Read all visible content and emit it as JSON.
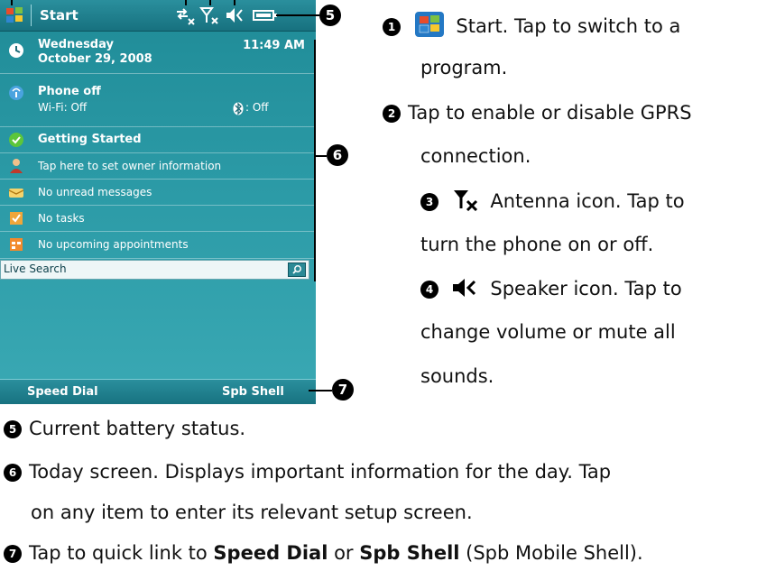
{
  "phone": {
    "title": "Start",
    "today": {
      "date_line1": "Wednesday",
      "date_line2": "October 29, 2008",
      "time": "11:49 AM",
      "phone_title": "Phone off",
      "wifi_status": "Wi-Fi: Off",
      "bluetooth_status": ": Off",
      "getting_started": "Getting Started",
      "owner_info": "Tap here to set owner information",
      "messages": "No unread messages",
      "tasks": "No tasks",
      "appointments": "No upcoming appointments",
      "search_label": "Live Search"
    },
    "softkeys": {
      "left": "Speed Dial",
      "right": "Spb Shell"
    }
  },
  "callout_numbers": {
    "n5": "5",
    "n6": "6",
    "n7": "7"
  },
  "descriptions": {
    "d1": {
      "num": "1",
      "text": "Start. Tap to switch to a",
      "text2": "program."
    },
    "d2": {
      "num": "2",
      "text": "Tap to enable or disable GPRS",
      "text2": "connection."
    },
    "d3": {
      "num": "3",
      "text": "Antenna icon. Tap to",
      "text2": "turn the phone on or off."
    },
    "d4": {
      "num": "4",
      "text": "Speaker icon. Tap to",
      "text2": "change volume or mute all",
      "text3": "sounds."
    },
    "d5": {
      "num": "5",
      "text": "Current battery status."
    },
    "d6": {
      "num": "6",
      "text": "Today screen. Displays important information for the day. Tap",
      "text2": "on any item to enter its relevant setup screen."
    },
    "d7": {
      "num": "7",
      "text_prefix": "Tap to quick link to ",
      "bold1": "Speed Dial",
      "or": " or ",
      "bold2": "Spb Shell",
      "suffix": " (Spb Mobile Shell)."
    }
  },
  "colors": {
    "screen_teal": "#2b9aa6",
    "titlebar": "#17717f",
    "text_white": "#ffffff"
  }
}
